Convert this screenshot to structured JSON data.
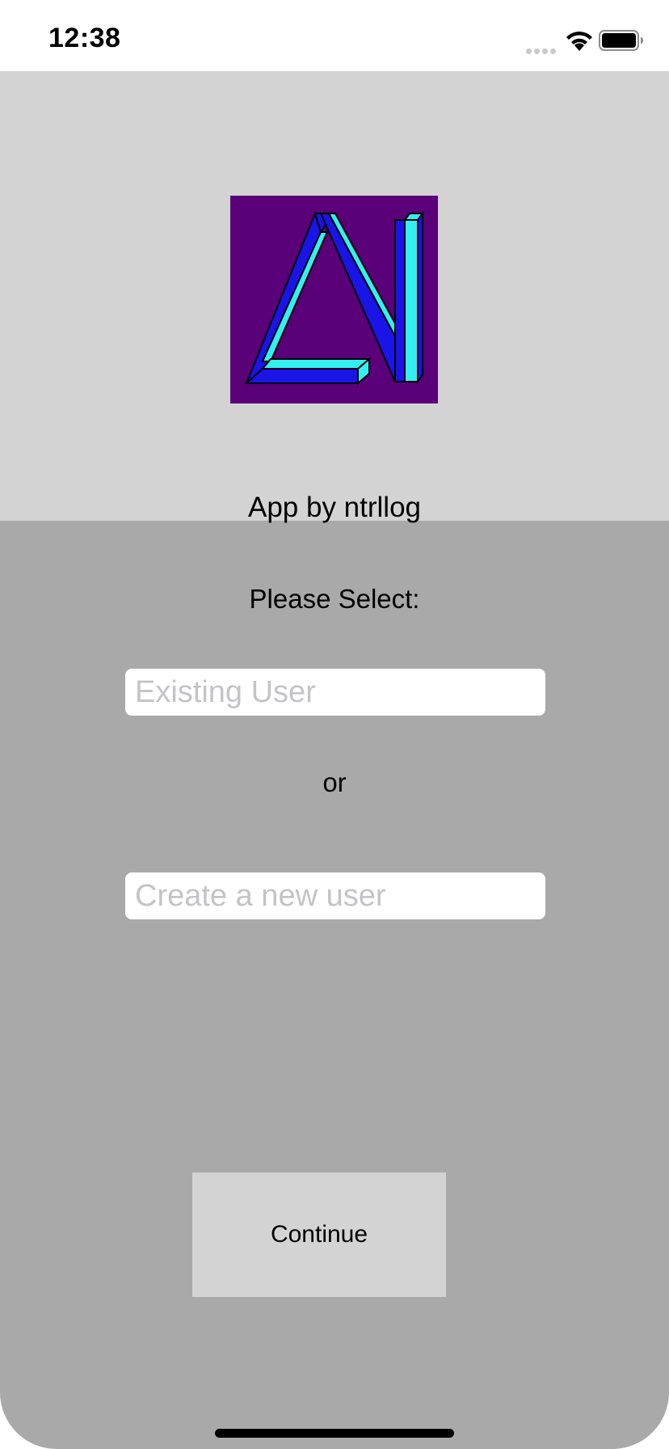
{
  "status_bar": {
    "time": "12:38",
    "icons": [
      "signal-dots-icon",
      "wifi-icon",
      "battery-icon"
    ]
  },
  "header": {
    "logo_icon": "triangle-logo-icon",
    "credit": "App by ntrllog",
    "background_color": "#d3d3d3",
    "logo_background": "#5a0078",
    "logo_fill": "#1a14e6",
    "logo_highlight": "#33f0f0"
  },
  "main": {
    "select_label": "Please Select:",
    "existing_user": {
      "value": "",
      "placeholder": "Existing User"
    },
    "or_label": "or",
    "new_user": {
      "value": "",
      "placeholder": "Create a new user"
    },
    "continue_label": "Continue",
    "background_color": "#a9a9a9"
  }
}
